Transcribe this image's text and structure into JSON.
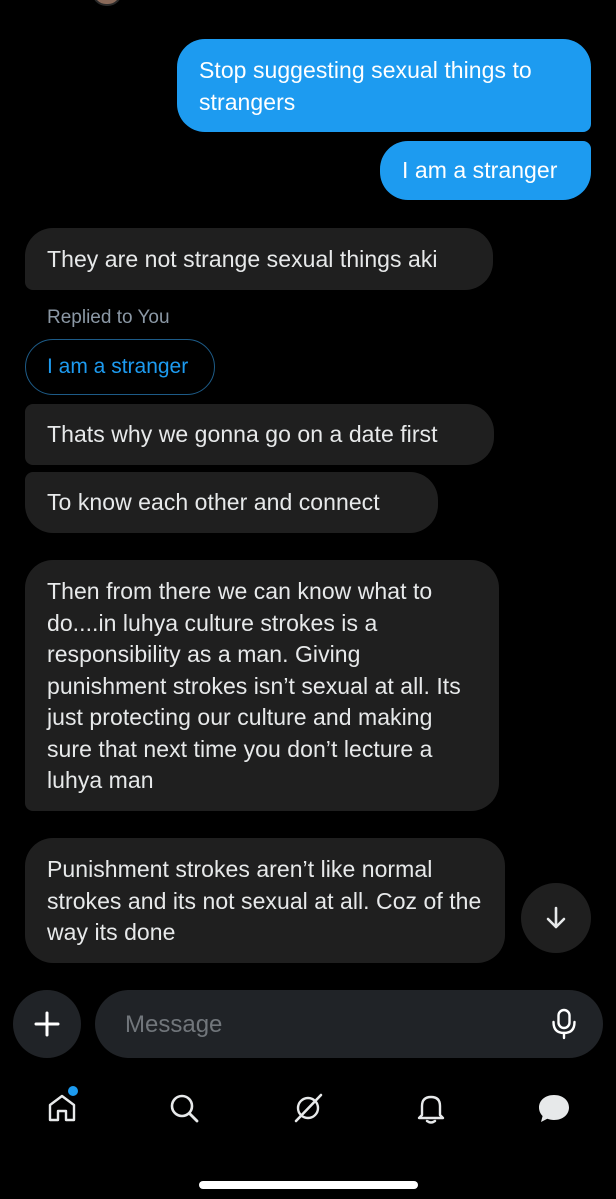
{
  "messages": {
    "out_1": "Stop suggesting sexual things to strangers",
    "out_2": "I am a stranger",
    "in_1": "They are not strange sexual things aki",
    "reply_label": "Replied to You",
    "reply_quote": "I am a stranger",
    "in_2": "Thats why we gonna go on a date first",
    "in_3": "To know each other and connect",
    "in_4": "Then from there we can know what to do....in luhya culture strokes is a responsibility as a man. Giving punishment strokes isn’t sexual at all. Its just protecting our culture and making sure that next time you don’t lecture a luhya man",
    "in_5": "Punishment strokes aren’t like normal strokes and its not sexual at all. Coz of the way its done"
  },
  "composer": {
    "placeholder": "Message",
    "plus_icon": "plus-icon",
    "mic_icon": "microphone-icon"
  },
  "tabs": [
    "home-icon",
    "search-icon",
    "grok-icon",
    "bell-icon",
    "messages-icon"
  ],
  "colors": {
    "accent": "#1d9bf0",
    "incoming_bubble": "#1f1f1f",
    "background": "#000000"
  }
}
